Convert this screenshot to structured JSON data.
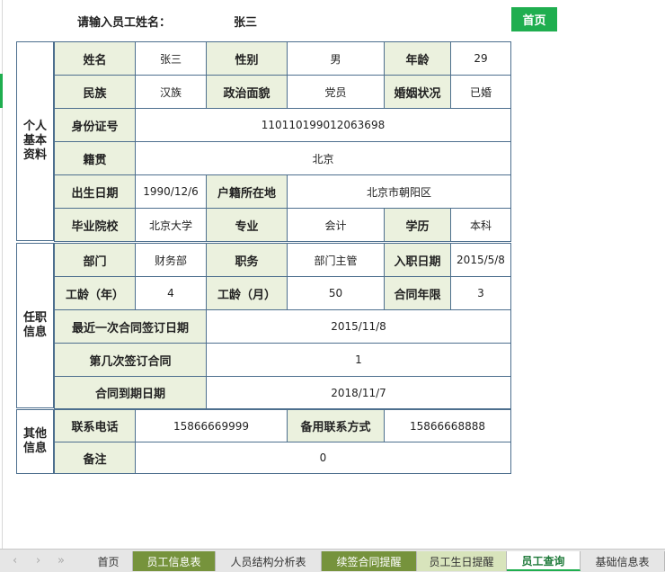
{
  "header": {
    "prompt_label": "请输入员工姓名：",
    "employee_name": "张三",
    "home_button": "首页"
  },
  "sections": {
    "personal": "个人基本资料",
    "job": "任职信息",
    "other": "其他信息"
  },
  "personal": {
    "name_label": "姓名",
    "name_value": "张三",
    "gender_label": "性别",
    "gender_value": "男",
    "age_label": "年龄",
    "age_value": "29",
    "ethnicity_label": "民族",
    "ethnicity_value": "汉族",
    "political_label": "政治面貌",
    "political_value": "党员",
    "marital_label": "婚姻状况",
    "marital_value": "已婚",
    "id_label": "身份证号",
    "id_value": "110110199012063698",
    "native_label": "籍贯",
    "native_value": "北京",
    "birth_label": "出生日期",
    "birth_value": "1990/12/6",
    "hukou_label": "户籍所在地",
    "hukou_value": "北京市朝阳区",
    "school_label": "毕业院校",
    "school_value": "北京大学",
    "major_label": "专业",
    "major_value": "会计",
    "degree_label": "学历",
    "degree_value": "本科"
  },
  "job": {
    "dept_label": "部门",
    "dept_value": "财务部",
    "position_label": "职务",
    "position_value": "部门主管",
    "hire_label": "入职日期",
    "hire_value": "2015/5/8",
    "tenure_years_label": "工龄（年）",
    "tenure_years_value": "4",
    "tenure_months_label": "工龄（月）",
    "tenure_months_value": "50",
    "contract_term_label": "合同年限",
    "contract_term_value": "3",
    "last_sign_label": "最近一次合同签订日期",
    "last_sign_value": "2015/11/8",
    "sign_count_label": "第几次签订合同",
    "sign_count_value": "1",
    "expiry_label": "合同到期日期",
    "expiry_value": "2018/11/7"
  },
  "other": {
    "phone_label": "联系电话",
    "phone_value": "15866669999",
    "alt_contact_label": "备用联系方式",
    "alt_contact_value": "15866668888",
    "notes_label": "备注",
    "notes_value": "0"
  },
  "tabs": [
    {
      "label": "首页"
    },
    {
      "label": "员工信息表"
    },
    {
      "label": "人员结构分析表"
    },
    {
      "label": "续签合同提醒"
    },
    {
      "label": "员工生日提醒"
    },
    {
      "label": "员工查询"
    },
    {
      "label": "基础信息表"
    }
  ],
  "colors": {
    "accent": "#1fae4f",
    "label_bg": "#ebf1de",
    "border": "#4d6f8e",
    "tab_green": "#76933c",
    "tab_light": "#d8e4bc"
  }
}
